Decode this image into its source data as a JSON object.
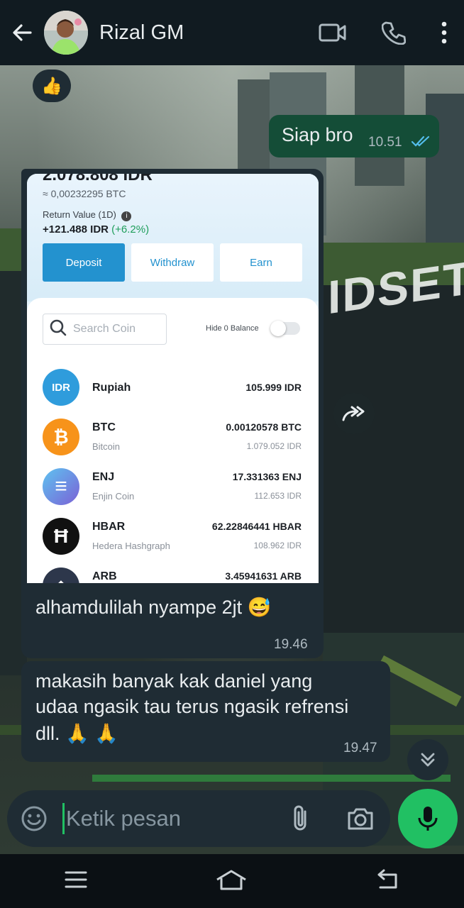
{
  "header": {
    "contact_name": "Rizal GM",
    "icons": [
      "back-arrow-icon",
      "video-call-icon",
      "voice-call-icon",
      "more-menu-icon"
    ]
  },
  "messages": [
    {
      "type": "reaction",
      "emoji": "👍"
    },
    {
      "type": "outgoing",
      "text": "Siap bro",
      "time": "10.51",
      "status": "read"
    },
    {
      "type": "incoming_image",
      "caption": "alhamdulilah nyampe 2jt 😅",
      "time": "19.46",
      "screenshot": {
        "balance_partial": "2.078.808 IDR",
        "btc_equiv": "≈ 0,00232295 BTC",
        "return_label": "Return Value (1D)",
        "return_value": "+121.488 IDR",
        "return_pct": "(+6.2%)",
        "buttons": [
          "Deposit",
          "Withdraw",
          "Earn"
        ],
        "search_placeholder": "Search Coin",
        "hide_zero_label": "Hide 0 Balance",
        "coins": [
          {
            "icon_text": "IDR",
            "symbol": "Rupiah",
            "name": "",
            "amount": "105.999 IDR",
            "idr": "",
            "color": "#2f9cdc"
          },
          {
            "icon_text": "₿",
            "symbol": "BTC",
            "name": "Bitcoin",
            "amount": "0.00120578 BTC",
            "idr": "1.079.052 IDR",
            "color": "#f7931a"
          },
          {
            "icon_text": "≡",
            "symbol": "ENJ",
            "name": "Enjin Coin",
            "amount": "17.331363 ENJ",
            "idr": "112.653 IDR",
            "color": "#7866d5"
          },
          {
            "icon_text": "Ħ",
            "symbol": "HBAR",
            "name": "Hedera Hashgraph",
            "amount": "62.22846441 HBAR",
            "idr": "108.962 IDR",
            "color": "#111111"
          },
          {
            "icon_text": "◆",
            "symbol": "ARB",
            "name": "",
            "amount": "3.45941631 ARB",
            "idr": "",
            "color": "#2d374b"
          }
        ]
      }
    },
    {
      "type": "incoming",
      "text_lines": [
        "makasih banyak kak daniel yang",
        "udaa ngasik tau terus ngasik refrensi",
        "dll. 🙏 🙏"
      ],
      "time": "19.47"
    }
  ],
  "input": {
    "placeholder": "Ketik pesan",
    "icons": [
      "emoji-icon",
      "attach-icon",
      "camera-icon",
      "mic-icon"
    ]
  },
  "nav": {
    "icons": [
      "recent-apps-icon",
      "home-icon",
      "back-nav-icon"
    ]
  },
  "colors": {
    "header_bg": "#111b21",
    "outgoing_bubble": "#144d37",
    "incoming_bubble": "#1f2c34",
    "accent_green": "#21c063",
    "read_tick": "#53bdeb",
    "deposit_blue": "#2392cf"
  }
}
